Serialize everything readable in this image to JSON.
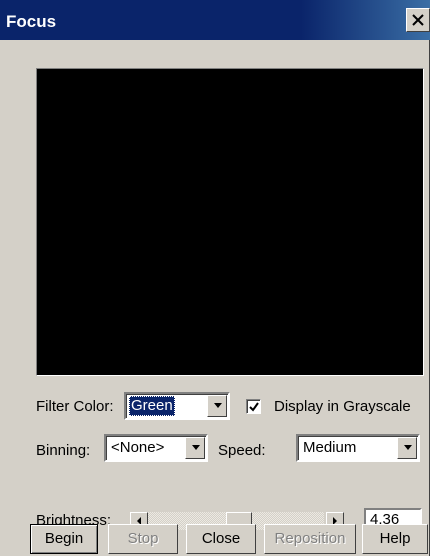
{
  "window": {
    "title": "Focus"
  },
  "filter_color": {
    "label": "Filter Color:",
    "value": "Green"
  },
  "display_grayscale": {
    "label": "Display in Grayscale",
    "checked": true
  },
  "binning": {
    "label": "Binning:",
    "value": "<None>"
  },
  "speed": {
    "label": "Speed:",
    "value": "Medium"
  },
  "brightness": {
    "label": "Brightness:",
    "value": "4.36",
    "slider_fraction": 0.52
  },
  "buttons": {
    "begin": "Begin",
    "stop": "Stop",
    "close": "Close",
    "reposition": "Reposition",
    "help": "Help"
  },
  "colors": {
    "titlebar": "#0a246a",
    "face": "#d4d0c8",
    "preview": "#000000"
  }
}
